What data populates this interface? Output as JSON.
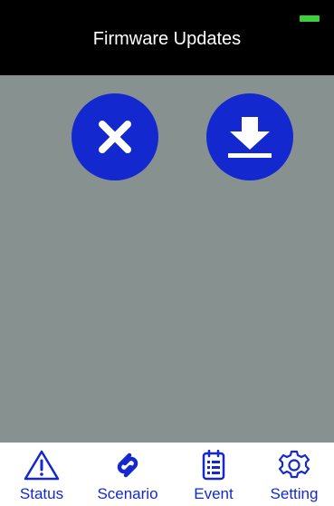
{
  "header": {
    "title": "Firmware Updates",
    "battery_color": "#3bd13b",
    "background": "#000000"
  },
  "content": {
    "background": "#869190",
    "buttons": [
      {
        "name": "cancel",
        "icon": "close-icon",
        "color": "#1329cf"
      },
      {
        "name": "download",
        "icon": "download-icon",
        "color": "#1329cf"
      }
    ]
  },
  "tabbar": {
    "accent": "#1329cf",
    "tabs": [
      {
        "label": "Status",
        "icon": "warning-triangle-icon"
      },
      {
        "label": "Scenario",
        "icon": "link-icon"
      },
      {
        "label": "Event",
        "icon": "calendar-list-icon"
      },
      {
        "label": "Setting",
        "icon": "gear-icon"
      }
    ]
  }
}
